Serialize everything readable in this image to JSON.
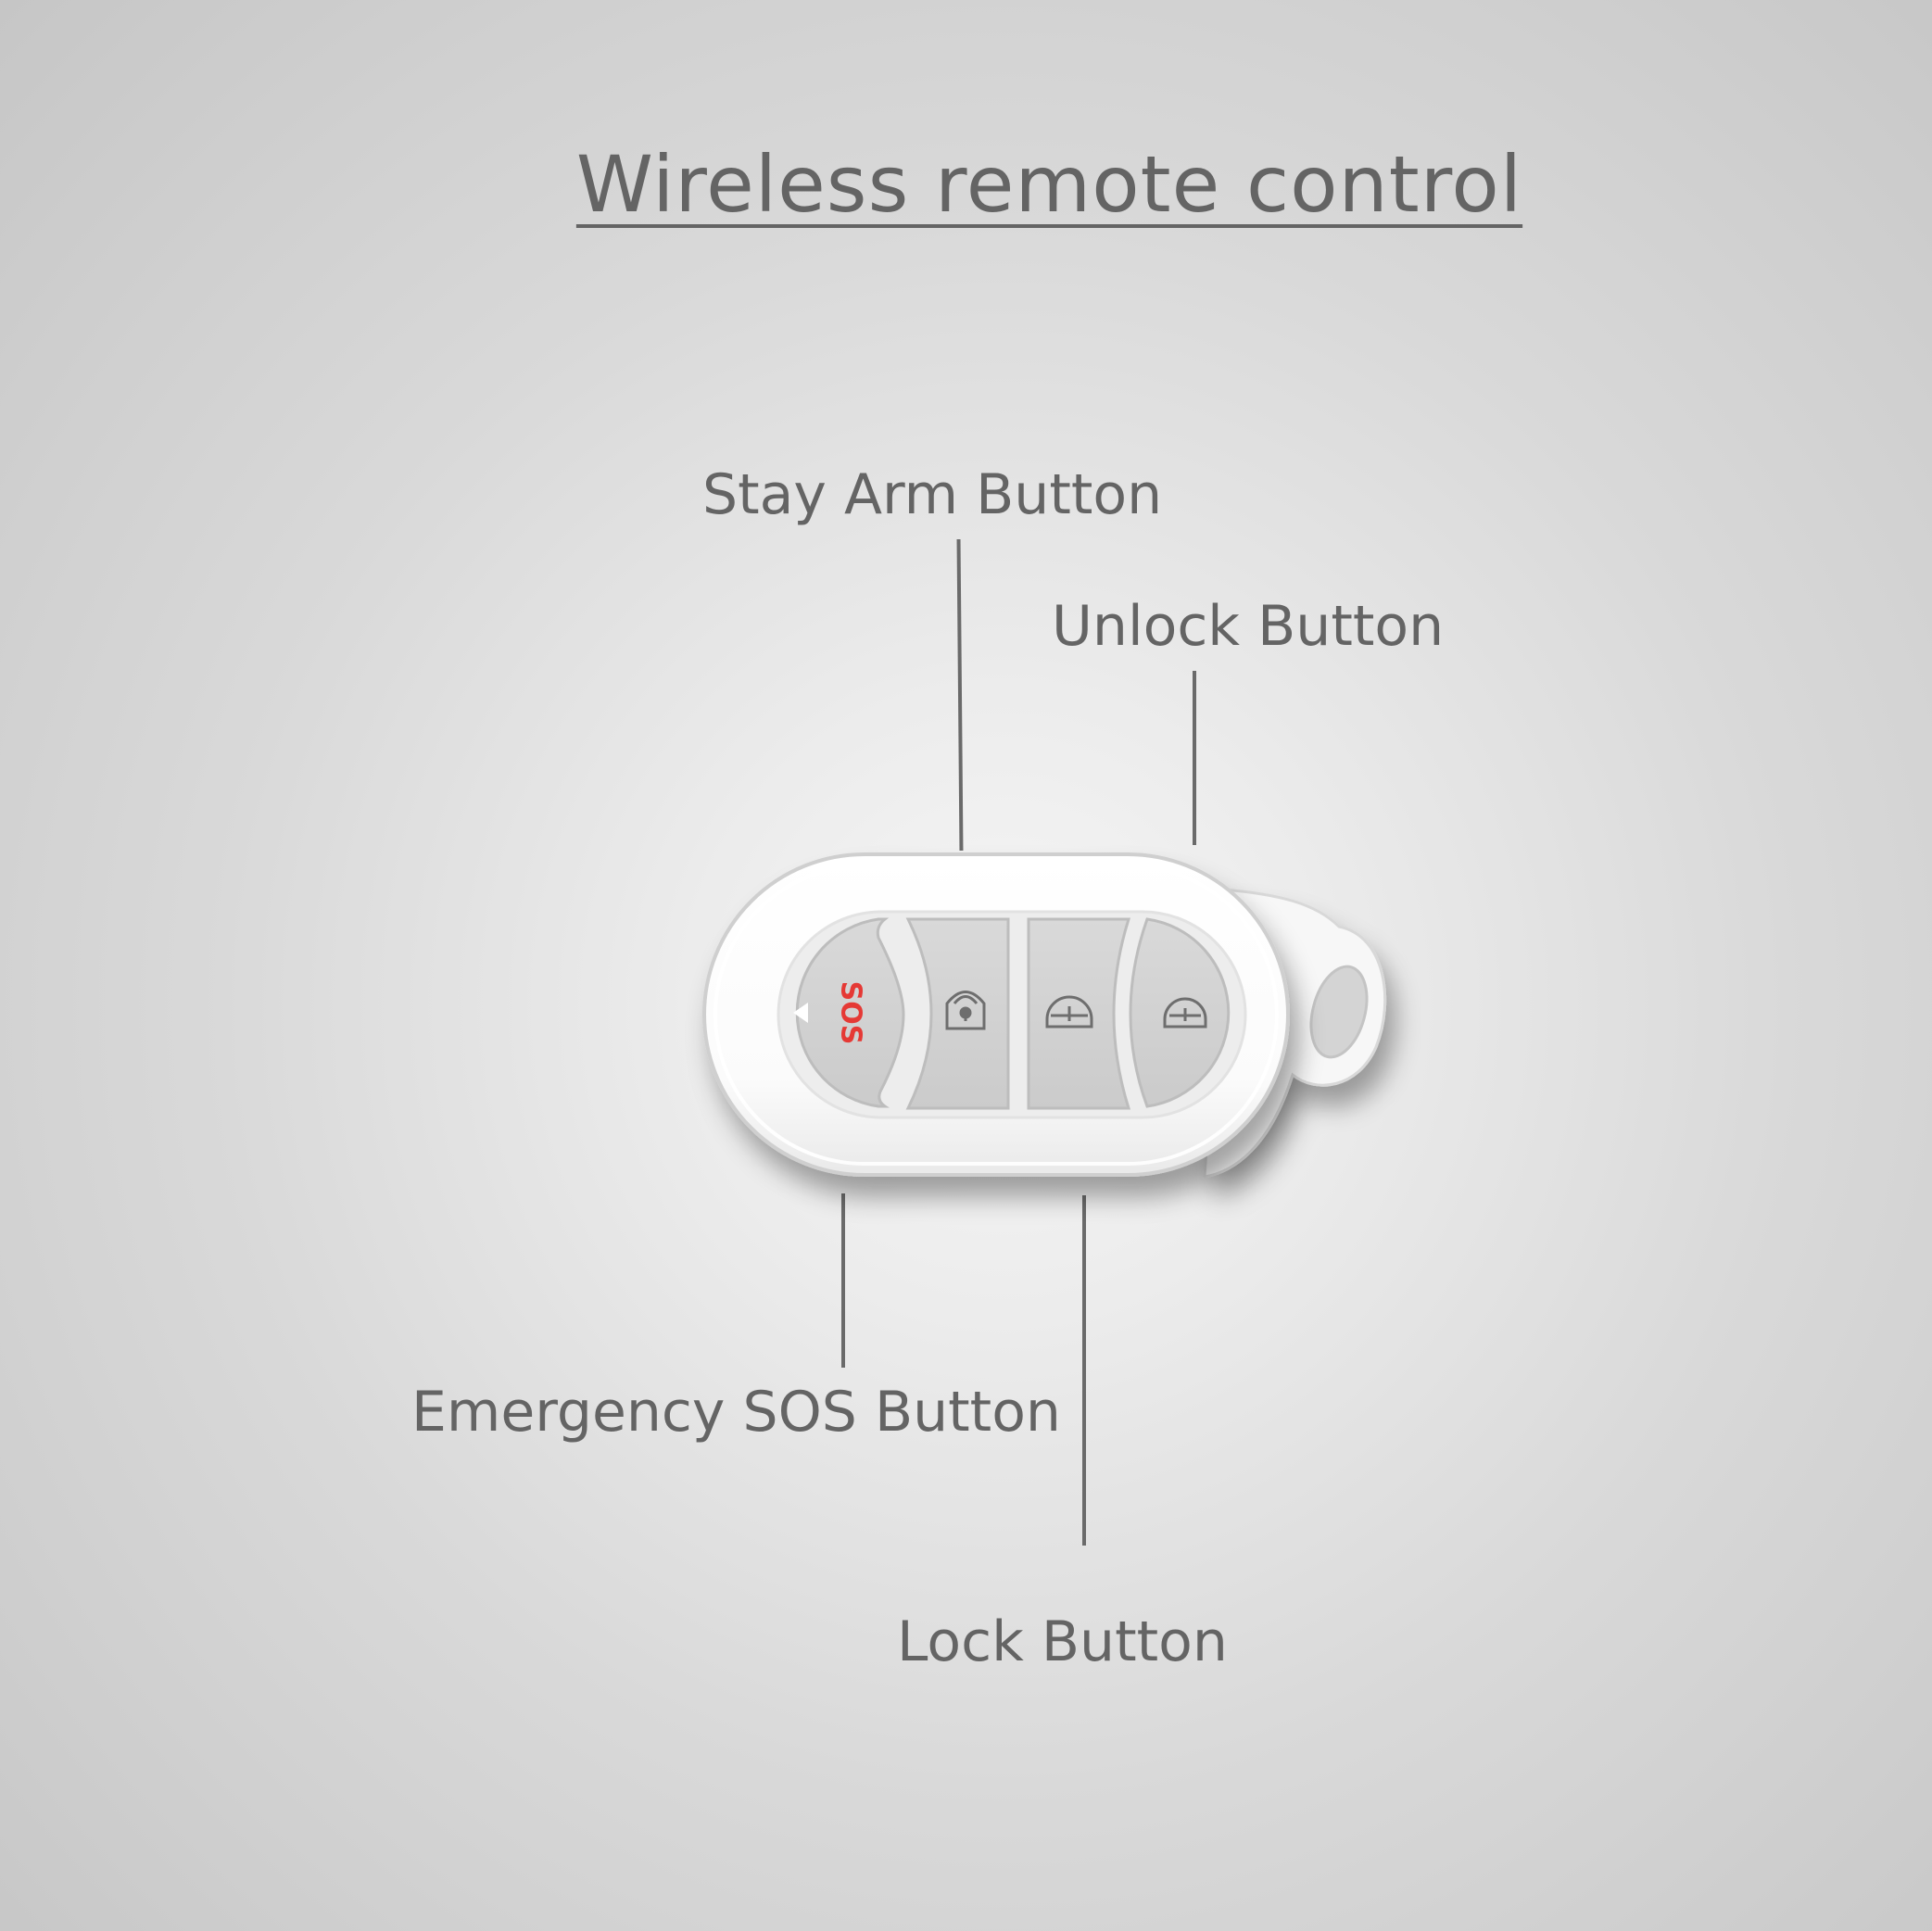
{
  "title": "Wireless remote control",
  "labels": {
    "stay_arm": "Stay Arm Button",
    "unlock": "Unlock Button",
    "emergency_sos": "Emergency SOS Button",
    "lock": "Lock Button"
  },
  "device": {
    "sos_text": "SOS",
    "sos_color": "#e53935",
    "body_color": "#ffffff",
    "button_color": "#d3d3d3",
    "icons": [
      "sos-text",
      "house-lock-icon",
      "lock-closed-icon",
      "lock-open-icon"
    ]
  },
  "colors": {
    "text": "#646464",
    "leader_line": "#6a6a6a"
  }
}
